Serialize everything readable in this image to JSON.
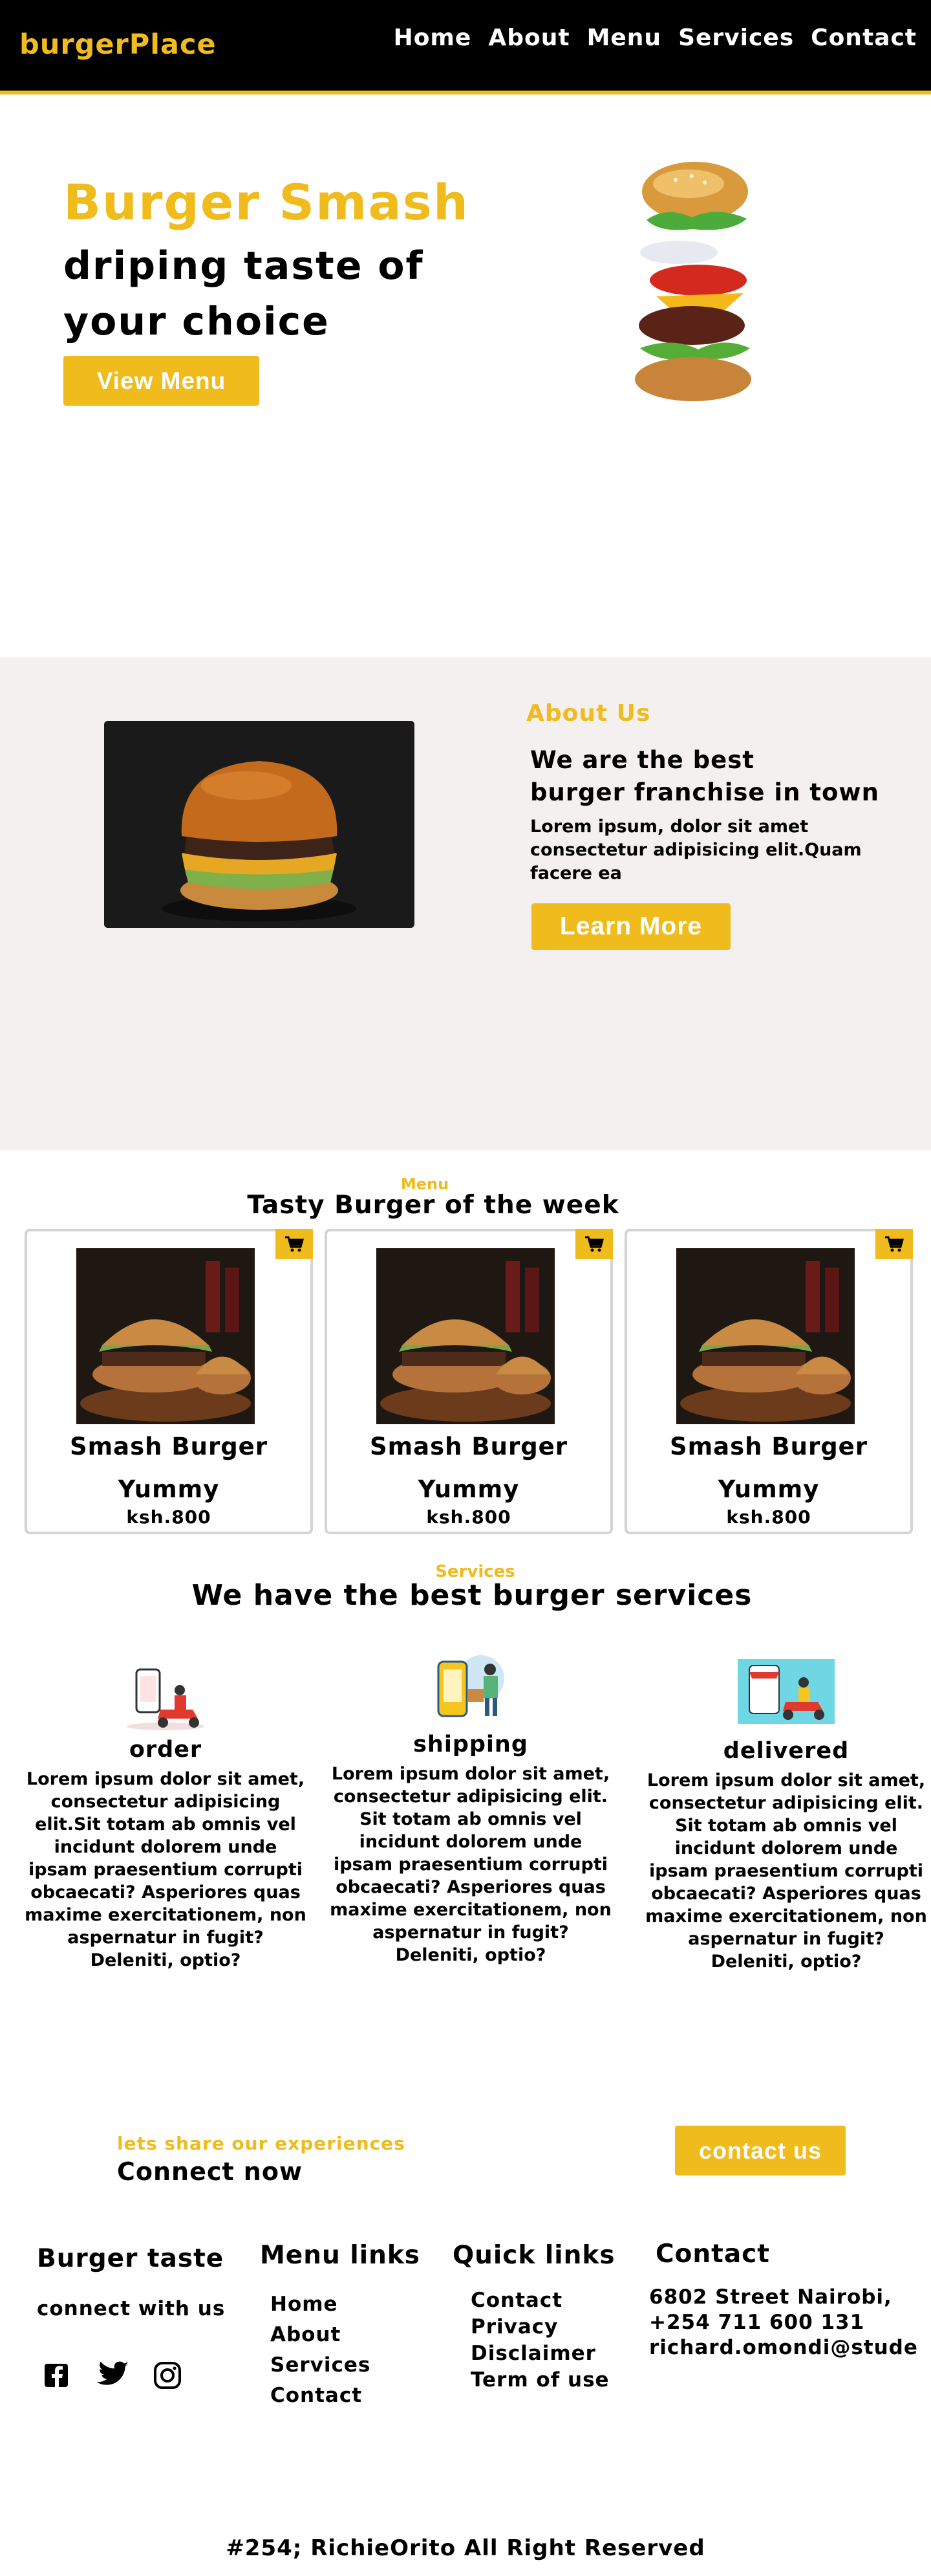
{
  "nav": {
    "brand": "burgerPlace",
    "links": [
      "Home",
      "About",
      "Menu",
      "Services",
      "Contact"
    ]
  },
  "hero": {
    "title": "Burger Smash",
    "subtitle_line1": "driping taste of",
    "subtitle_line2": "your choice",
    "button": "View Menu"
  },
  "about": {
    "kicker": "About Us",
    "heading_line1": "We are the best",
    "heading_line2": "burger franchise in town",
    "text": "Lorem ipsum, dolor sit amet consectetur adipisicing elit.Quam facere ea",
    "button": "Learn More"
  },
  "menu": {
    "kicker": "Menu",
    "title": "Tasty Burger of the week",
    "items": [
      {
        "name_line1": "Smash Burger",
        "name_line2": "Yummy",
        "price": "ksh.800"
      },
      {
        "name_line1": "Smash Burger",
        "name_line2": "Yummy",
        "price": "ksh.800"
      },
      {
        "name_line1": "Smash Burger",
        "name_line2": "Yummy",
        "price": "ksh.800"
      }
    ]
  },
  "services": {
    "kicker": "Services",
    "title": "We have the best burger services",
    "items": [
      {
        "name": "order",
        "text": "Lorem ipsum dolor sit amet, consectetur adipisicing elit.Sit totam ab omnis vel incidunt dolorem unde ipsam praesentium corrupti obcaecati? Asperiores quas maxime exercitationem, non aspernatur in fugit? Deleniti, optio?"
      },
      {
        "name": "shipping",
        "text": "Lorem ipsum dolor sit amet, consectetur adipisicing elit. Sit totam ab omnis vel incidunt dolorem unde ipsam praesentium corrupti obcaecati? Asperiores quas maxime exercitationem, non aspernatur in fugit? Deleniti, optio?"
      },
      {
        "name": "delivered",
        "text": "Lorem ipsum dolor sit amet, consectetur adipisicing elit. Sit totam ab omnis vel incidunt dolorem unde ipsam praesentium corrupti obcaecati? Asperiores quas maxime exercitationem, non aspernatur in fugit? Deleniti, optio?"
      }
    ]
  },
  "connect": {
    "kicker": "lets share our experiences",
    "title": "Connect now",
    "button": "contact us"
  },
  "footer": {
    "brand_heading": "Burger taste",
    "connect_text": "connect with us",
    "menu_heading": "Menu links",
    "menu_links": [
      "Home",
      "About",
      "Services",
      "Contact"
    ],
    "quick_heading": "Quick links",
    "quick_links": [
      "Contact",
      "Privacy",
      "Disclaimer",
      "Term of use"
    ],
    "contact_heading": "Contact",
    "address": "6802 Street Nairobi,",
    "phone": "+254 711 600 131",
    "email": "richard.omondi@stude",
    "copyright": "#254; RichieOrito All Right Reserved"
  },
  "colors": {
    "accent": "#f0bb1c",
    "nav_bg": "#000000",
    "about_bg": "#f5f0f0"
  },
  "icons": [
    "cart-icon",
    "facebook-icon",
    "twitter-icon",
    "instagram-icon"
  ]
}
